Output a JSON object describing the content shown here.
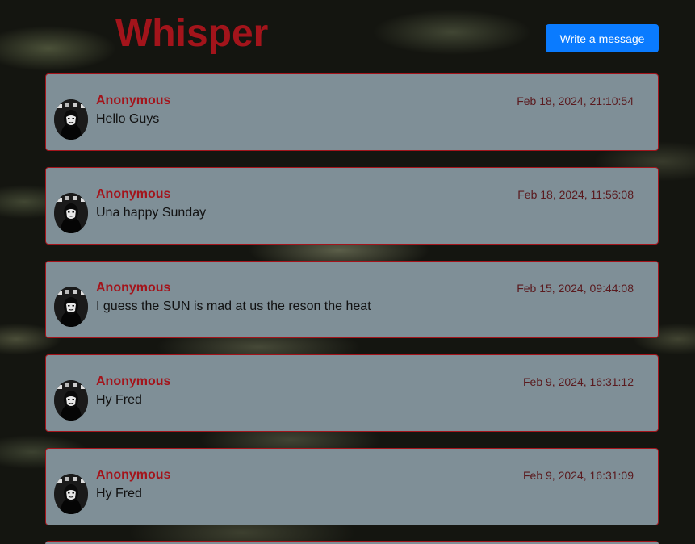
{
  "header": {
    "title": "Whisper",
    "write_button_label": "Write a message"
  },
  "colors": {
    "accent": "#a3141b",
    "button": "#0a7bff",
    "card": "#7f8f97"
  },
  "messages": [
    {
      "author": "Anonymous",
      "timestamp": "Feb 18, 2024, 21:10:54",
      "text": "Hello Guys"
    },
    {
      "author": "Anonymous",
      "timestamp": "Feb 18, 2024, 11:56:08",
      "text": "Una happy Sunday"
    },
    {
      "author": "Anonymous",
      "timestamp": "Feb 15, 2024, 09:44:08",
      "text": "I guess the SUN is mad at us the reson the heat"
    },
    {
      "author": "Anonymous",
      "timestamp": "Feb 9, 2024, 16:31:12",
      "text": "Hy Fred"
    },
    {
      "author": "Anonymous",
      "timestamp": "Feb 9, 2024, 16:31:09",
      "text": "Hy Fred"
    }
  ],
  "avatar_icon": "anonymous-mask-icon"
}
